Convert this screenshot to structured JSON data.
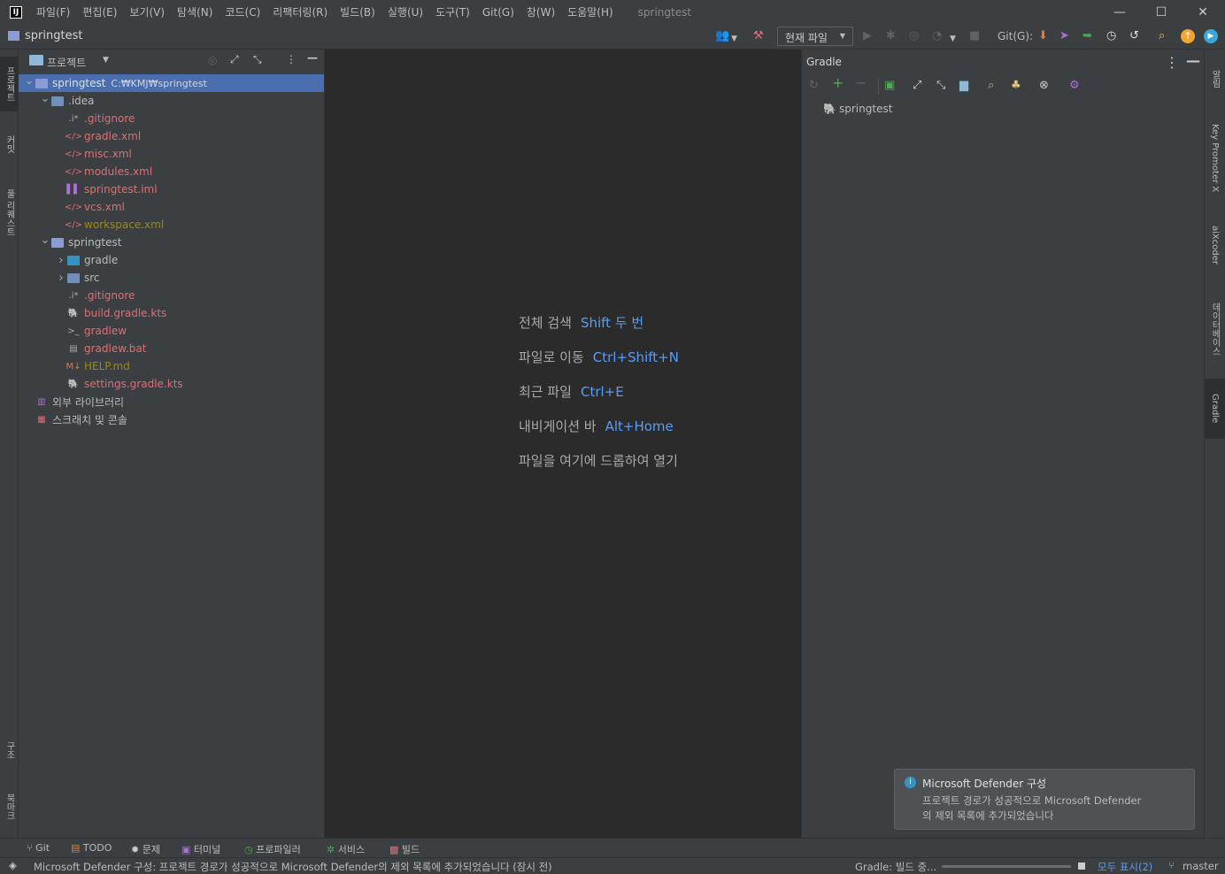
{
  "menubar": {
    "items": [
      "파일(F)",
      "편집(E)",
      "보기(V)",
      "탐색(N)",
      "코드(C)",
      "리팩터링(R)",
      "빌드(B)",
      "실행(U)",
      "도구(T)",
      "Git(G)",
      "창(W)",
      "도움말(H)"
    ],
    "window_title": "springtest",
    "minimize": "—",
    "maximize": "☐",
    "close": "✕"
  },
  "toolbar": {
    "project_name": "springtest",
    "run_config": "현재 파일",
    "git_label": "Git(G):"
  },
  "left_strip": {
    "tabs": [
      "프로젝트",
      "커밋",
      "풀 리퀘스트",
      "구조",
      "북마크"
    ]
  },
  "project_panel": {
    "title": "프로젝트",
    "tree": [
      {
        "label": "springtest",
        "extra": "C:₩KMJ₩springtest",
        "depth": 0,
        "arrow": "open",
        "icon": "project-folder-icon",
        "color": "#dfe1e5",
        "selected": true
      },
      {
        "label": ".idea",
        "depth": 1,
        "arrow": "open",
        "icon": "folder-icon",
        "color": "#bbbbbb"
      },
      {
        "label": ".gitignore",
        "depth": 2,
        "icon": "ignore-file-icon",
        "color": "#e06c75"
      },
      {
        "label": "gradle.xml",
        "depth": 2,
        "icon": "xml-file-icon",
        "color": "#e06c75"
      },
      {
        "label": "misc.xml",
        "depth": 2,
        "icon": "xml-file-icon",
        "color": "#e06c75"
      },
      {
        "label": "modules.xml",
        "depth": 2,
        "icon": "xml-file-icon",
        "color": "#e06c75"
      },
      {
        "label": "springtest.iml",
        "depth": 2,
        "icon": "iml-file-icon",
        "color": "#e06c75"
      },
      {
        "label": "vcs.xml",
        "depth": 2,
        "icon": "xml-file-icon",
        "color": "#e06c75"
      },
      {
        "label": "workspace.xml",
        "depth": 2,
        "icon": "xml-file-icon",
        "color": "#9e880d"
      },
      {
        "label": "springtest",
        "depth": 1,
        "arrow": "open",
        "icon": "module-folder-icon",
        "color": "#bbbbbb"
      },
      {
        "label": "gradle",
        "depth": 2,
        "arrow": "closed",
        "icon": "gradle-folder-icon",
        "color": "#bbbbbb"
      },
      {
        "label": "src",
        "depth": 2,
        "arrow": "closed",
        "icon": "src-folder-icon",
        "color": "#bbbbbb"
      },
      {
        "label": ".gitignore",
        "depth": 2,
        "icon": "ignore-file-icon",
        "color": "#e06c75"
      },
      {
        "label": "build.gradle.kts",
        "depth": 2,
        "icon": "gradle-file-icon",
        "color": "#e06c75"
      },
      {
        "label": "gradlew",
        "depth": 2,
        "icon": "shell-file-icon",
        "color": "#e06c75"
      },
      {
        "label": "gradlew.bat",
        "depth": 2,
        "icon": "text-file-icon",
        "color": "#e06c75"
      },
      {
        "label": "HELP.md",
        "depth": 2,
        "icon": "markdown-file-icon",
        "color": "#9e880d"
      },
      {
        "label": "settings.gradle.kts",
        "depth": 2,
        "icon": "gradle-file-icon",
        "color": "#e06c75"
      },
      {
        "label": "외부 라이브러리",
        "depth": 0,
        "icon": "library-icon",
        "color": "#bbbbbb"
      },
      {
        "label": "스크래치 및 콘솔",
        "depth": 0,
        "icon": "scratch-icon",
        "color": "#bbbbbb"
      }
    ]
  },
  "editor_hints": [
    {
      "text": "전체 검색",
      "key": "Shift 두 번"
    },
    {
      "text": "파일로 이동",
      "key": "Ctrl+Shift+N"
    },
    {
      "text": "최근 파일",
      "key": "Ctrl+E"
    },
    {
      "text": "내비게이션 바",
      "key": "Alt+Home"
    },
    {
      "text": "파일을 여기에 드롭하여 열기",
      "key": ""
    }
  ],
  "gradle_panel": {
    "title": "Gradle",
    "project": "springtest"
  },
  "right_strip": {
    "tabs": [
      "알림",
      "Key Promoter X",
      "aiXcoder",
      "데이터베이스",
      "Gradle"
    ]
  },
  "notification": {
    "title": "Microsoft Defender 구성",
    "body_line1": "프로젝트 경로가 성공적으로 Microsoft Defender",
    "body_line2": "의 제외 목록에 추가되었습니다"
  },
  "bottom_tabs": [
    "Git",
    "TODO",
    "문제",
    "터미널",
    "프로파일러",
    "서비스",
    "빌드"
  ],
  "status_bar": {
    "message": "Microsoft Defender 구성: 프로젝트 경로가 성공적으로 Microsoft Defender의 제외 목록에 추가되었습니다 (잠시 전)",
    "gradle_status": "Gradle: 빌드 중...",
    "show_all": "모두 표시(2)",
    "branch": "master"
  },
  "colors": {
    "accent_blue": "#589df6",
    "selection": "#4b6eaf",
    "panel_bg": "#3c3f41",
    "editor_bg": "#2b2b2b"
  }
}
